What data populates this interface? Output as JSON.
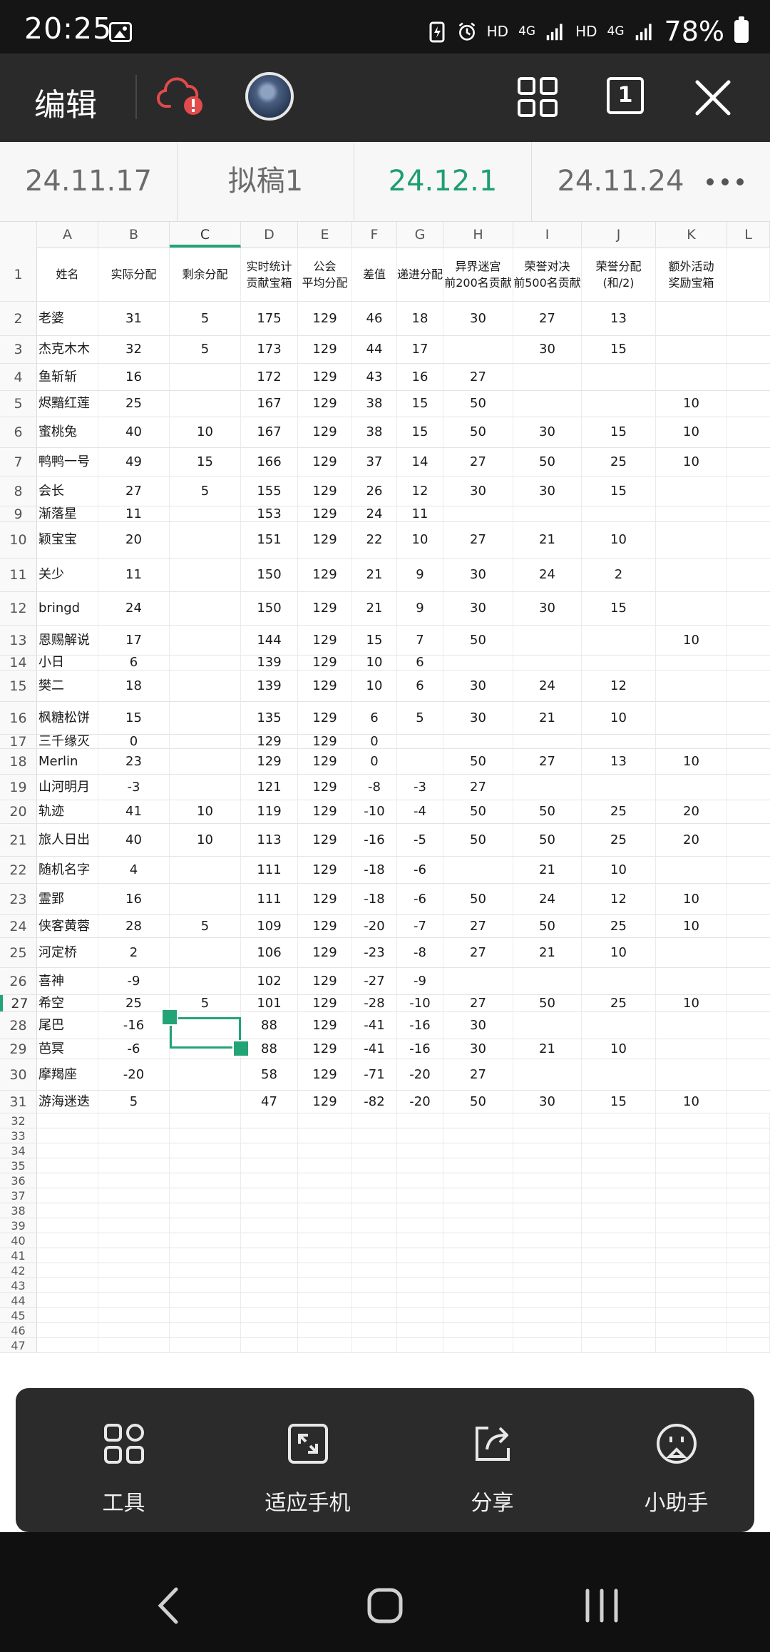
{
  "status_bar": {
    "time": "20:25",
    "net_label_1": "HD",
    "net_gen_1": "4G",
    "net_label_2": "HD",
    "net_gen_2": "4G",
    "battery_percent": "78%"
  },
  "toolbar": {
    "edit_label": "编辑",
    "page_count": "1"
  },
  "sheet_tabs": [
    {
      "label": "24.11.17",
      "active": false
    },
    {
      "label": "拟稿1",
      "active": false
    },
    {
      "label": "24.12.1",
      "active": true
    },
    {
      "label": "24.11.24",
      "active": false
    }
  ],
  "columns": [
    "",
    "A",
    "B",
    "C",
    "D",
    "E",
    "F",
    "G",
    "H",
    "I",
    "J",
    "K",
    "L"
  ],
  "header_row": [
    "姓名",
    "实际分配",
    "剩余分配",
    "实时统计\n贡献宝箱",
    "公会\n平均分配",
    "差值",
    "递进分配",
    "异界迷宫\n前200名贡献",
    "荣誉对决\n前500名贡献",
    "荣誉分配\n(和/2)",
    "额外活动\n奖励宝箱",
    ""
  ],
  "rows": [
    [
      "老婆",
      "31",
      "5",
      "175",
      "129",
      "46",
      "18",
      "30",
      "27",
      "13",
      ""
    ],
    [
      "杰克木木",
      "32",
      "5",
      "173",
      "129",
      "44",
      "17",
      "",
      "30",
      "15",
      ""
    ],
    [
      "鱼斩斩",
      "16",
      "",
      "172",
      "129",
      "43",
      "16",
      "27",
      "",
      "",
      ""
    ],
    [
      "烬黯红莲",
      "25",
      "",
      "167",
      "129",
      "38",
      "15",
      "50",
      "",
      "",
      "10"
    ],
    [
      "蜜桃兔",
      "40",
      "10",
      "167",
      "129",
      "38",
      "15",
      "50",
      "30",
      "15",
      "10"
    ],
    [
      "鸭鸭一号",
      "49",
      "15",
      "166",
      "129",
      "37",
      "14",
      "27",
      "50",
      "25",
      "10"
    ],
    [
      "会长",
      "27",
      "5",
      "155",
      "129",
      "26",
      "12",
      "30",
      "30",
      "15",
      ""
    ],
    [
      "渐落星",
      "11",
      "",
      "153",
      "129",
      "24",
      "11",
      "",
      "",
      "",
      ""
    ],
    [
      "颖宝宝",
      "20",
      "",
      "151",
      "129",
      "22",
      "10",
      "27",
      "21",
      "10",
      ""
    ],
    [
      "关少",
      "11",
      "",
      "150",
      "129",
      "21",
      "9",
      "30",
      "24",
      "2",
      ""
    ],
    [
      "bringd",
      "24",
      "",
      "150",
      "129",
      "21",
      "9",
      "30",
      "30",
      "15",
      ""
    ],
    [
      "恩赐解说",
      "17",
      "",
      "144",
      "129",
      "15",
      "7",
      "50",
      "",
      "",
      "10"
    ],
    [
      "小日",
      "6",
      "",
      "139",
      "129",
      "10",
      "6",
      "",
      "",
      "",
      ""
    ],
    [
      "樊二",
      "18",
      "",
      "139",
      "129",
      "10",
      "6",
      "30",
      "24",
      "12",
      ""
    ],
    [
      "枫糖松饼",
      "15",
      "",
      "135",
      "129",
      "6",
      "5",
      "30",
      "21",
      "10",
      ""
    ],
    [
      "三千缘灭",
      "0",
      "",
      "129",
      "129",
      "0",
      "",
      "",
      "",
      "",
      ""
    ],
    [
      "Merlin",
      "23",
      "",
      "129",
      "129",
      "0",
      "",
      "50",
      "27",
      "13",
      "10"
    ],
    [
      "山河明月",
      "-3",
      "",
      "121",
      "129",
      "-8",
      "-3",
      "27",
      "",
      "",
      ""
    ],
    [
      "轨迹",
      "41",
      "10",
      "119",
      "129",
      "-10",
      "-4",
      "50",
      "50",
      "25",
      "20"
    ],
    [
      "旅人日出",
      "40",
      "10",
      "113",
      "129",
      "-16",
      "-5",
      "50",
      "50",
      "25",
      "20"
    ],
    [
      "随机名字",
      "4",
      "",
      "111",
      "129",
      "-18",
      "-6",
      "",
      "21",
      "10",
      ""
    ],
    [
      "霊郢",
      "16",
      "",
      "111",
      "129",
      "-18",
      "-6",
      "50",
      "24",
      "12",
      "10"
    ],
    [
      "侠客黄蓉",
      "28",
      "5",
      "109",
      "129",
      "-20",
      "-7",
      "27",
      "50",
      "25",
      "10"
    ],
    [
      "河定桥",
      "2",
      "",
      "106",
      "129",
      "-23",
      "-8",
      "27",
      "21",
      "10",
      ""
    ],
    [
      "喜神",
      "-9",
      "",
      "102",
      "129",
      "-27",
      "-9",
      "",
      "",
      "",
      ""
    ],
    [
      "希空",
      "25",
      "5",
      "101",
      "129",
      "-28",
      "-10",
      "27",
      "50",
      "25",
      "10"
    ],
    [
      "尾巴",
      "-16",
      "",
      "88",
      "129",
      "-41",
      "-16",
      "30",
      "",
      "",
      ""
    ],
    [
      "芭冥",
      "-6",
      "",
      "88",
      "129",
      "-41",
      "-16",
      "30",
      "21",
      "10",
      ""
    ],
    [
      "摩羯座",
      "-20",
      "",
      "58",
      "129",
      "-71",
      "-20",
      "27",
      "",
      "",
      ""
    ],
    [
      "游海迷迭",
      "5",
      "",
      "47",
      "129",
      "-82",
      "-20",
      "50",
      "30",
      "15",
      "10"
    ]
  ],
  "empty_rows": [
    "32",
    "33",
    "34",
    "35",
    "36",
    "37",
    "38",
    "39",
    "40",
    "41",
    "42",
    "43",
    "44",
    "45",
    "46",
    "47"
  ],
  "active_cell": {
    "row": "27",
    "column": "C"
  },
  "bottom_tools": [
    {
      "label": "工具",
      "icon": "tools-icon"
    },
    {
      "label": "适应手机",
      "icon": "fit-screen-icon"
    },
    {
      "label": "分享",
      "icon": "share-icon"
    },
    {
      "label": "小助手",
      "icon": "assistant-icon"
    }
  ],
  "accent_color": "#22a476"
}
